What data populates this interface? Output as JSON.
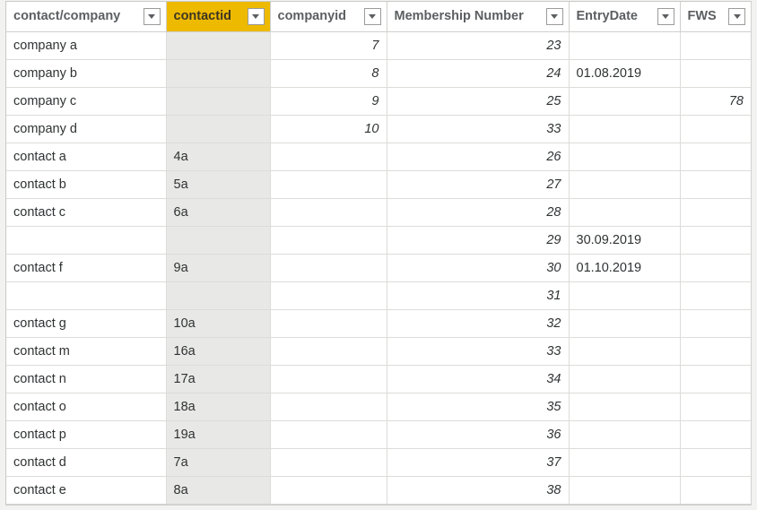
{
  "grid": {
    "selected_header_color": "#eeba00",
    "shaded_column_color": "#e8e8e6",
    "header_text_color": "#5b5f61",
    "columns": [
      {
        "key": "contact_company",
        "label": "contact/company",
        "align": "left",
        "italic": false,
        "shaded": false,
        "filter_icon": "chevron-down-icon",
        "selected": false
      },
      {
        "key": "contactid",
        "label": "contactid",
        "align": "left",
        "italic": false,
        "shaded": true,
        "filter_icon": "chevron-down-icon",
        "selected": true
      },
      {
        "key": "companyid",
        "label": "companyid",
        "align": "right",
        "italic": true,
        "shaded": false,
        "filter_icon": "chevron-down-icon",
        "selected": false
      },
      {
        "key": "membership",
        "label": "Membership Number",
        "align": "right",
        "italic": true,
        "shaded": false,
        "filter_icon": "chevron-down-icon",
        "selected": false
      },
      {
        "key": "entrydate",
        "label": "EntryDate",
        "align": "left",
        "italic": false,
        "shaded": false,
        "filter_icon": "chevron-down-icon",
        "selected": false
      },
      {
        "key": "fws",
        "label": "FWS",
        "align": "right",
        "italic": true,
        "shaded": false,
        "filter_icon": "chevron-down-icon",
        "selected": false
      }
    ],
    "rows": [
      {
        "contact_company": "company a",
        "contactid": "",
        "companyid": "7",
        "membership": "23",
        "entrydate": "",
        "fws": ""
      },
      {
        "contact_company": "company b",
        "contactid": "",
        "companyid": "8",
        "membership": "24",
        "entrydate": "01.08.2019",
        "fws": ""
      },
      {
        "contact_company": "company c",
        "contactid": "",
        "companyid": "9",
        "membership": "25",
        "entrydate": "",
        "fws": "78"
      },
      {
        "contact_company": "company d",
        "contactid": "",
        "companyid": "10",
        "membership": "33",
        "entrydate": "",
        "fws": ""
      },
      {
        "contact_company": "contact a",
        "contactid": "4a",
        "companyid": "",
        "membership": "26",
        "entrydate": "",
        "fws": ""
      },
      {
        "contact_company": "contact b",
        "contactid": "5a",
        "companyid": "",
        "membership": "27",
        "entrydate": "",
        "fws": ""
      },
      {
        "contact_company": "contact c",
        "contactid": "6a",
        "companyid": "",
        "membership": "28",
        "entrydate": "",
        "fws": ""
      },
      {
        "contact_company": "",
        "contactid": "",
        "companyid": "",
        "membership": "29",
        "entrydate": "30.09.2019",
        "fws": ""
      },
      {
        "contact_company": "contact f",
        "contactid": "9a",
        "companyid": "",
        "membership": "30",
        "entrydate": "01.10.2019",
        "fws": ""
      },
      {
        "contact_company": "",
        "contactid": "",
        "companyid": "",
        "membership": "31",
        "entrydate": "",
        "fws": ""
      },
      {
        "contact_company": "contact g",
        "contactid": "10a",
        "companyid": "",
        "membership": "32",
        "entrydate": "",
        "fws": ""
      },
      {
        "contact_company": "contact m",
        "contactid": "16a",
        "companyid": "",
        "membership": "33",
        "entrydate": "",
        "fws": ""
      },
      {
        "contact_company": "contact n",
        "contactid": "17a",
        "companyid": "",
        "membership": "34",
        "entrydate": "",
        "fws": ""
      },
      {
        "contact_company": "contact o",
        "contactid": "18a",
        "companyid": "",
        "membership": "35",
        "entrydate": "",
        "fws": ""
      },
      {
        "contact_company": "contact p",
        "contactid": "19a",
        "companyid": "",
        "membership": "36",
        "entrydate": "",
        "fws": ""
      },
      {
        "contact_company": "contact d",
        "contactid": "7a",
        "companyid": "",
        "membership": "37",
        "entrydate": "",
        "fws": ""
      },
      {
        "contact_company": "contact e",
        "contactid": "8a",
        "companyid": "",
        "membership": "38",
        "entrydate": "",
        "fws": ""
      }
    ]
  }
}
